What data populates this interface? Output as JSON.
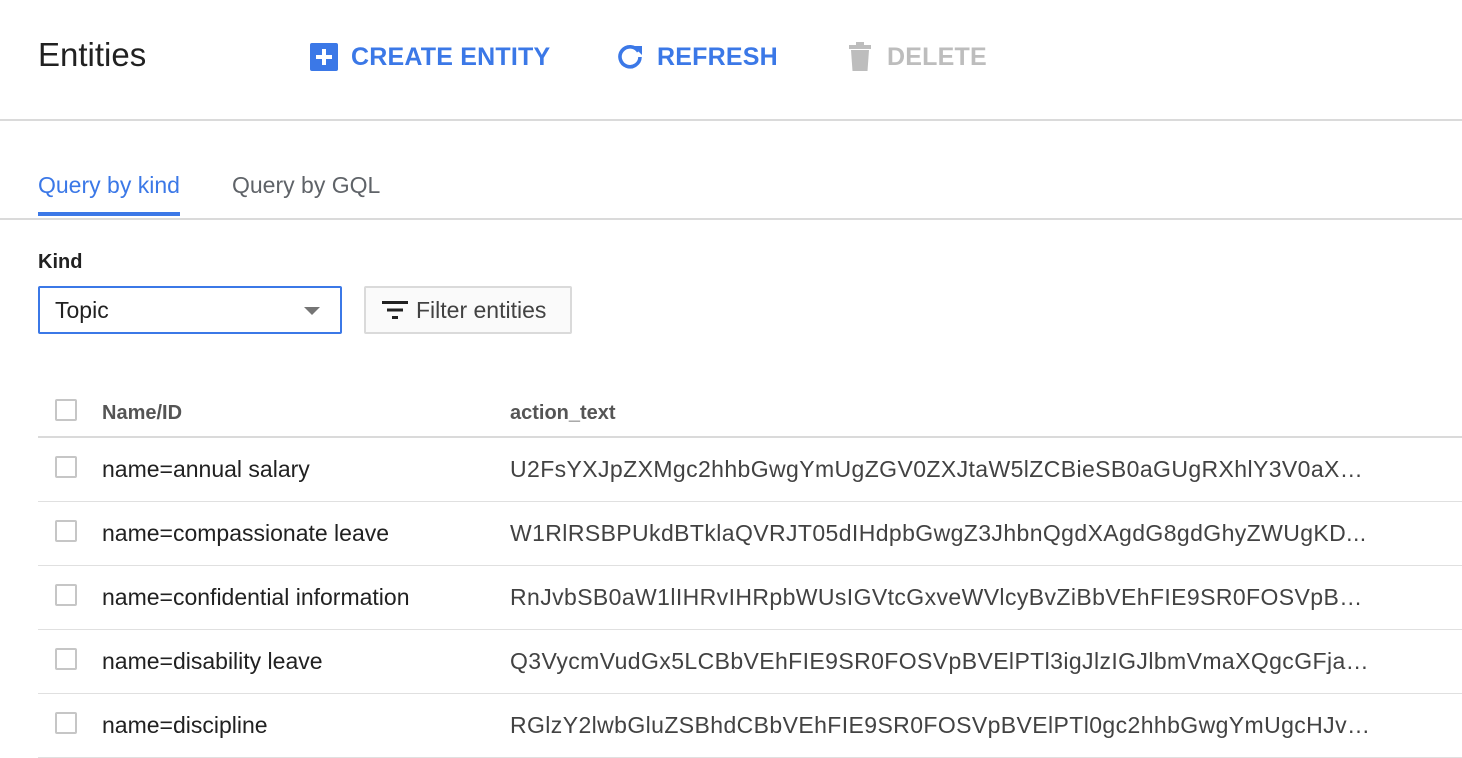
{
  "header": {
    "title": "Entities",
    "create_label": "CREATE ENTITY",
    "refresh_label": "REFRESH",
    "delete_label": "DELETE"
  },
  "tabs": [
    {
      "label": "Query by kind",
      "active": true
    },
    {
      "label": "Query by GQL",
      "active": false
    }
  ],
  "query": {
    "kind_label": "Kind",
    "kind_value": "Topic",
    "filter_label": "Filter entities"
  },
  "table": {
    "columns": [
      "Name/ID",
      "action_text"
    ],
    "rows": [
      {
        "name": "name=annual salary",
        "action_text": "U2FsYXJpZXMgc2hhbGwgYmUgZGV0ZXJtaW5lZCBieSB0aGUgRXhlY3V0aXZ..."
      },
      {
        "name": "name=compassionate leave",
        "action_text": "W1RlRSBPUkdBTklaQVRJT05dIHdpbGwgZ3JhbnQgdXAgdG8gdGhyZWUgKD..."
      },
      {
        "name": "name=confidential information",
        "action_text": "RnJvbSB0aW1lIHRvIHRpbWUsIGVtcGxveWVlcyBvZiBbVEhFIE9SR0FOSVpBVE..."
      },
      {
        "name": "name=disability leave",
        "action_text": "Q3VycmVudGx5LCBbVEhFIE9SR0FOSVpBVElPTl3igJlzIGJlbmVmaXQgcGFja2..."
      },
      {
        "name": "name=discipline",
        "action_text": "RGlzY2lwbGluZSBhdCBbVEhFIE9SR0FOSVpBVElPTl0gc2hhbGwgYmUgcHJvZ..."
      }
    ]
  },
  "colors": {
    "accent": "#3b78e7",
    "disabled": "#bdbdbd",
    "divider": "#dadada"
  }
}
